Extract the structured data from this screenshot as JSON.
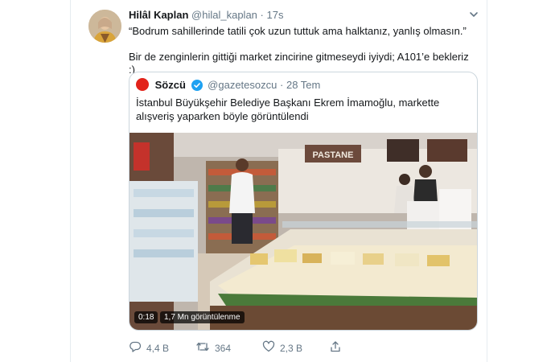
{
  "tweet": {
    "author_name": "Hilâl Kaplan",
    "author_handle": "@hilal_kaplan",
    "time": "17s",
    "text_line1": "“Bodrum sahillerinde tatili çok uzun tuttuk ama halktanız, yanlış olmasın.”",
    "text_line2": "Bir de zenginlerin gittiği market zincirine gitmeseydi iyiydi; A101’e bekleriz :)"
  },
  "quote": {
    "name": "Sözcü",
    "handle": "@gazetesozcu",
    "date": "28 Tem",
    "text": "İstanbul Büyükşehir Belediye Başkanı Ekrem İmamoğlu, markette alışveriş yaparken böyle görüntülendi",
    "video": {
      "duration": "0:18",
      "views": "1,7 Mn görüntülenme",
      "store_sign": "PASTANE"
    }
  },
  "actions": {
    "reply_count": "4,4 B",
    "retweet_count": "364",
    "like_count": "2,3 B"
  },
  "colors": {
    "text": "#14171a",
    "secondary": "#657786",
    "border": "#ccd6dd",
    "verified": "#1da1f2",
    "brand_red": "#e2231a"
  },
  "icons": [
    "chevron-down-icon",
    "verified-icon",
    "reply-icon",
    "retweet-icon",
    "like-icon",
    "share-icon"
  ]
}
